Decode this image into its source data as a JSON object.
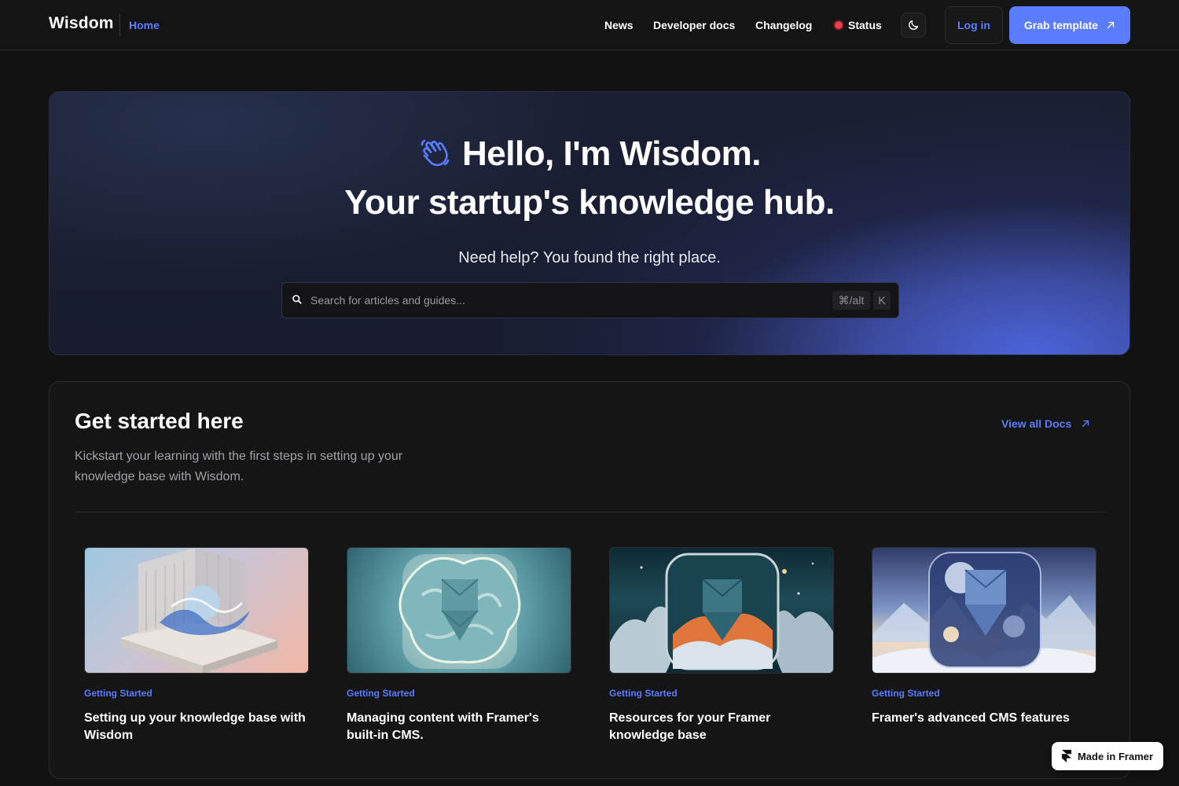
{
  "nav": {
    "brand": "Wisdom",
    "home": "Home",
    "links": [
      "News",
      "Developer docs",
      "Changelog",
      "Status"
    ],
    "login": "Log in",
    "cta": "Grab template"
  },
  "hero": {
    "title": "Hello, I'm Wisdom.",
    "subtitle": "Your startup's knowledge hub.",
    "help": "Need help? You found the right place.",
    "search": {
      "placeholder": "Search for articles and guides...",
      "shortcut_mod": "⌘/alt",
      "shortcut_key": "K"
    }
  },
  "get_started": {
    "title": "Get started here",
    "description": "Kickstart your learning with the first steps in setting up your knowledge base with Wisdom.",
    "view_all": "View all Docs",
    "cards": [
      {
        "category": "Getting Started",
        "title": "Setting up your knowledge base with Wisdom"
      },
      {
        "category": "Getting Started",
        "title": "Managing content with Framer's built-in CMS."
      },
      {
        "category": "Getting Started",
        "title": "Resources for your Framer knowledge base"
      },
      {
        "category": "Getting Started",
        "title": "Framer's advanced CMS features"
      }
    ]
  },
  "badge": {
    "label": "Made in Framer"
  },
  "colors": {
    "accent": "#5b7cff",
    "status": "#ef3b4a",
    "background": "#121212"
  },
  "icons": [
    "waving-hand-icon",
    "moon-icon",
    "arrow-up-right-icon",
    "search-icon",
    "framer-logo-icon"
  ]
}
